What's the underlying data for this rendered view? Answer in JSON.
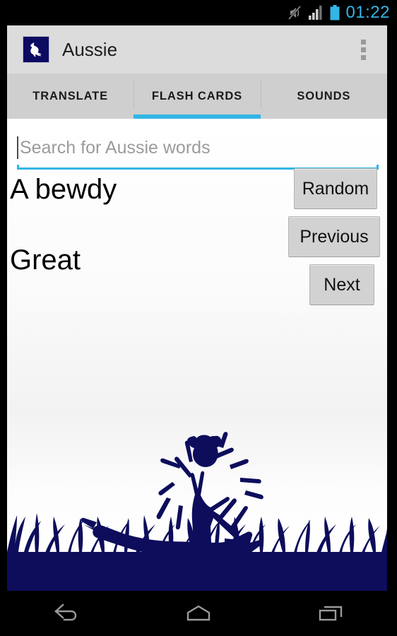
{
  "status_bar": {
    "clock": "01:22",
    "icons": [
      {
        "name": "mute-icon",
        "label": "ringer-silent"
      },
      {
        "name": "signal-icon",
        "label": "cellular-signal"
      },
      {
        "name": "battery-icon",
        "label": "battery-full"
      }
    ],
    "accent_color": "#33b5e5"
  },
  "action_bar": {
    "app_icon_name": "kangaroo-icon",
    "title": "Aussie",
    "overflow_label": "More options",
    "background_color": "#dcdcdc",
    "icon_background": "#0b0b62"
  },
  "tabs": {
    "items": [
      {
        "label": "TRANSLATE",
        "active": false
      },
      {
        "label": "FLASH CARDS",
        "active": true
      },
      {
        "label": "SOUNDS",
        "active": false
      }
    ],
    "indicator_color": "#33b5e5",
    "background_color": "#cfcfcf"
  },
  "search": {
    "value": "",
    "placeholder": "Search for Aussie words",
    "underline_color": "#33b5e5"
  },
  "flash_card": {
    "word": "A bewdy",
    "meaning": "Great"
  },
  "buttons": {
    "random": "Random",
    "previous": "Previous",
    "next": "Next",
    "face_color": "#d2d2d2"
  },
  "scenery": {
    "silhouette_color": "#0d0d5c",
    "elements": [
      "tree-silhouette",
      "koala-silhouette",
      "crocodile-silhouette",
      "grass-silhouette"
    ]
  },
  "nav_bar": {
    "buttons": [
      {
        "name": "back-button",
        "label": "Back"
      },
      {
        "name": "home-button",
        "label": "Home"
      },
      {
        "name": "recents-button",
        "label": "Recent apps"
      }
    ]
  }
}
